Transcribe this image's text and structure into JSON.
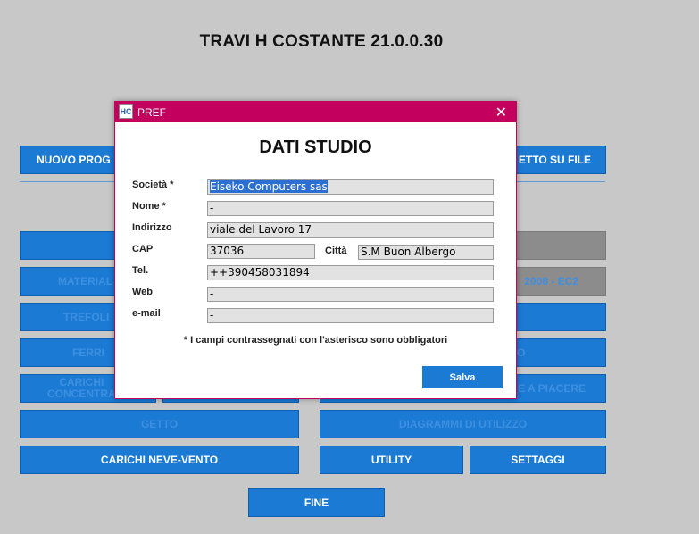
{
  "app": {
    "title": "TRAVI H COSTANTE  21.0.0.30"
  },
  "background": {
    "nuovo_prog": "NUOVO PROG",
    "getto_su_file": "ETTO SU FILE",
    "material": "MATERIAL",
    "ec2": "2008 - EC2",
    "trefoli": "TREFOLI",
    "ferri": "FERRI",
    "ferri_right": "O",
    "carichi_concentr": "CARICHI\nCONCENTRA",
    "a_piacere": "E A PIACERE",
    "getto": "GETTO",
    "diagrammi": "DIAGRAMMI DI UTILIZZO",
    "carichi_neve": "CARICHI NEVE-VENTO",
    "utility": "UTILITY",
    "settaggi": "SETTAGGI",
    "fine": "FINE"
  },
  "dialog": {
    "caption": "PREF",
    "close": "✕",
    "icon": "HC",
    "heading": "DATI STUDIO",
    "fields": {
      "societa": {
        "label": "Società *",
        "value": "Eiseko Computers sas"
      },
      "nome": {
        "label": "Nome *",
        "value": "-"
      },
      "indirizzo": {
        "label": "Indirizzo",
        "value": "viale del Lavoro 17"
      },
      "cap": {
        "label": "CAP",
        "value": "37036"
      },
      "citta": {
        "label": "Città",
        "value": "S.M Buon Albergo"
      },
      "tel": {
        "label": "Tel.",
        "value": "++390458031894"
      },
      "web": {
        "label": "Web",
        "value": "-"
      },
      "email": {
        "label": "e-mail",
        "value": "-"
      }
    },
    "note": "*  I campi contrassegnati con l'asterisco sono obbligatori",
    "save_label": "Salva"
  }
}
